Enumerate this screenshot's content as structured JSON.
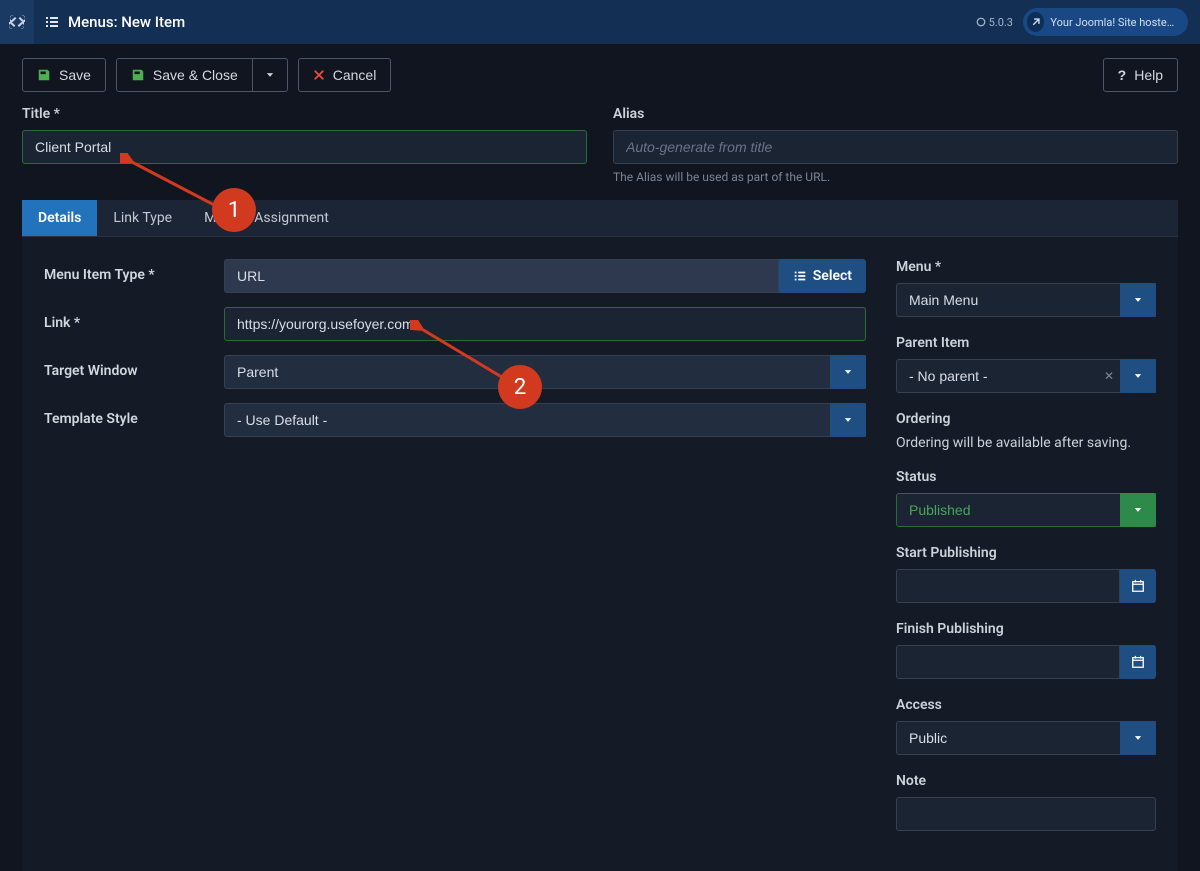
{
  "header": {
    "page_title": "Menus: New Item",
    "version": "5.0.3",
    "site_name": "Your Joomla! Site hosted wit…"
  },
  "toolbar": {
    "save": "Save",
    "save_close": "Save & Close",
    "cancel": "Cancel",
    "help": "Help"
  },
  "fields": {
    "title_label": "Title *",
    "title_value": "Client Portal",
    "alias_label": "Alias",
    "alias_placeholder": "Auto-generate from title",
    "alias_helper": "The Alias will be used as part of the URL."
  },
  "tabs": {
    "details": "Details",
    "link_type": "Link Type",
    "module_assignment": "Module Assignment"
  },
  "details": {
    "menu_item_type_label": "Menu Item Type *",
    "menu_item_type_value": "URL",
    "select_label": "Select",
    "link_label": "Link *",
    "link_value": "https://yourorg.usefoyer.com",
    "target_window_label": "Target Window",
    "target_window_value": "Parent",
    "template_style_label": "Template Style",
    "template_style_value": "- Use Default -"
  },
  "sidebar": {
    "menu_label": "Menu *",
    "menu_value": "Main Menu",
    "parent_label": "Parent Item",
    "parent_value": "- No parent -",
    "ordering_label": "Ordering",
    "ordering_text": "Ordering will be available after saving.",
    "status_label": "Status",
    "status_value": "Published",
    "start_publishing_label": "Start Publishing",
    "finish_publishing_label": "Finish Publishing",
    "access_label": "Access",
    "access_value": "Public",
    "note_label": "Note"
  },
  "callouts": {
    "one": "1",
    "two": "2"
  }
}
